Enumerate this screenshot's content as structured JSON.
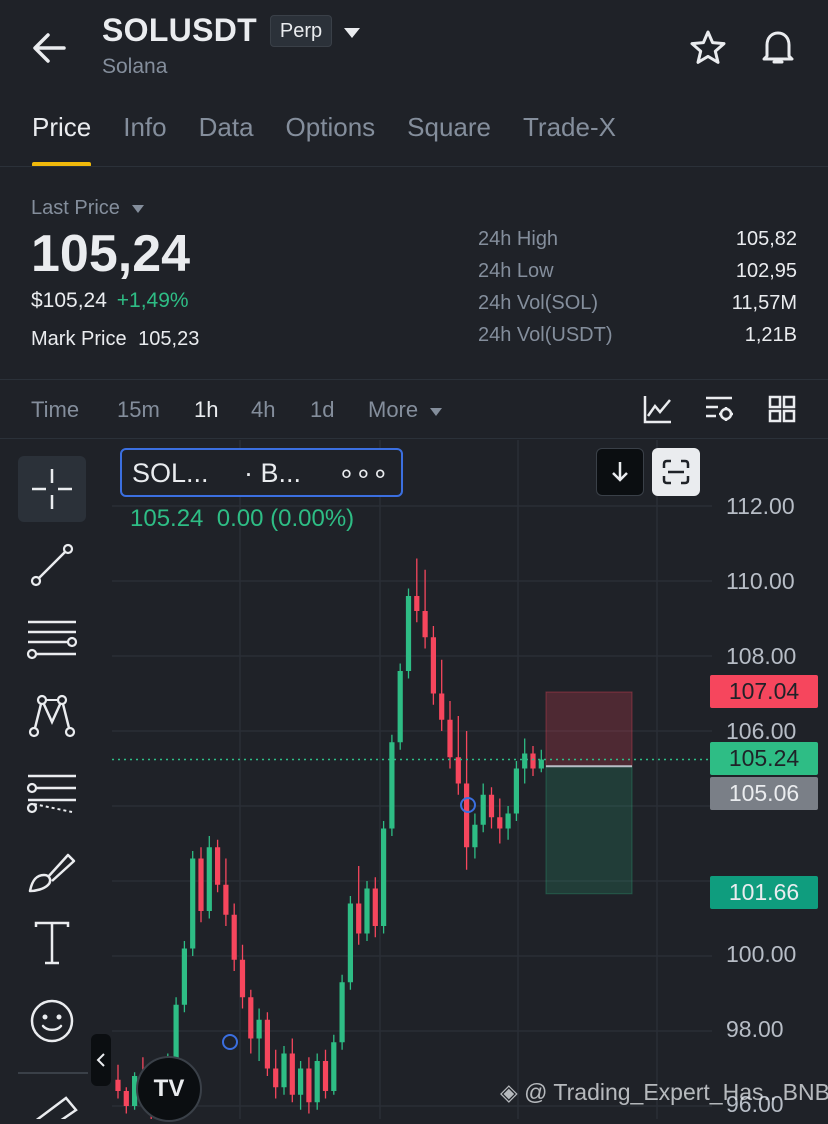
{
  "header": {
    "symbol": "SOLUSDT",
    "contract_type": "Perp",
    "name": "Solana"
  },
  "tabs": [
    "Price",
    "Info",
    "Data",
    "Options",
    "Square",
    "Trade-X"
  ],
  "active_tab": "Price",
  "ticker": {
    "last_price_label": "Last Price",
    "last_price": "105,24",
    "usd_price": "$105,24",
    "change_pct": "+1,49%",
    "mark_price_label": "Mark Price",
    "mark_price": "105,23",
    "stats": [
      {
        "label": "24h High",
        "value": "105,82"
      },
      {
        "label": "24h Low",
        "value": "102,95"
      },
      {
        "label": "24h Vol(SOL)",
        "value": "11,57M"
      },
      {
        "label": "24h Vol(USDT)",
        "value": "1,21B"
      }
    ]
  },
  "timeframes": {
    "time_label": "Time",
    "options": [
      "15m",
      "1h",
      "4h",
      "1d"
    ],
    "selected": "1h",
    "more_label": "More"
  },
  "chart": {
    "legend_symbol": "SOL...",
    "legend_exchange": "· B...",
    "legend_more": "∘∘∘",
    "ohlc_line": "105.24  0.00 (0.00%)",
    "axis_labels": [
      "112.00",
      "110.00",
      "108.00",
      "106.00",
      "100.00",
      "98.00",
      "96.00"
    ],
    "price_tags": [
      {
        "value": "107.04",
        "color": "#f6465d"
      },
      {
        "value": "105.24",
        "color": "#2ebd85"
      },
      {
        "value": "105.06",
        "color": "#7a7f87"
      },
      {
        "value": "101.66",
        "color": "#0f9d7e"
      }
    ],
    "watermark": "@ Trading_Expert_Has.. BNB",
    "colors": {
      "up": "#2ebd85",
      "down": "#f6465d",
      "bg": "#1f2228",
      "grid": "#2a2e36"
    }
  },
  "chart_data": {
    "type": "candlestick",
    "title": "",
    "ylim": [
      95.5,
      112.8
    ],
    "current_price": 105.24,
    "position": {
      "take_profit": 107.04,
      "entry": 105.06,
      "stop": 101.66
    },
    "series": [
      {
        "values": [
          [
            96.7,
            97.1,
            96.2,
            96.4
          ],
          [
            96.4,
            96.5,
            95.8,
            96.0
          ],
          [
            96.0,
            96.9,
            95.9,
            96.8
          ],
          [
            96.8,
            97.3,
            96.4,
            96.6
          ],
          [
            96.6,
            96.7,
            95.6,
            95.9
          ],
          [
            95.9,
            96.8,
            95.7,
            96.6
          ],
          [
            96.6,
            97.4,
            96.5,
            97.2
          ],
          [
            97.2,
            98.9,
            97.0,
            98.7
          ],
          [
            98.7,
            100.4,
            98.5,
            100.2
          ],
          [
            100.2,
            102.8,
            100.0,
            102.6
          ],
          [
            102.6,
            102.9,
            100.9,
            101.2
          ],
          [
            101.2,
            103.2,
            101.0,
            102.9
          ],
          [
            102.9,
            103.1,
            101.7,
            101.9
          ],
          [
            101.9,
            102.6,
            100.8,
            101.1
          ],
          [
            101.1,
            101.4,
            99.6,
            99.9
          ],
          [
            99.9,
            100.3,
            98.6,
            98.9
          ],
          [
            98.9,
            99.1,
            97.4,
            97.8
          ],
          [
            97.8,
            98.6,
            97.2,
            98.3
          ],
          [
            98.3,
            98.5,
            96.8,
            97.0
          ],
          [
            97.0,
            97.5,
            96.2,
            96.5
          ],
          [
            96.5,
            97.6,
            96.3,
            97.4
          ],
          [
            97.4,
            97.8,
            96.1,
            96.3
          ],
          [
            96.3,
            97.2,
            95.9,
            97.0
          ],
          [
            97.0,
            97.3,
            95.8,
            96.1
          ],
          [
            96.1,
            97.4,
            95.9,
            97.2
          ],
          [
            97.2,
            97.5,
            96.2,
            96.4
          ],
          [
            96.4,
            97.9,
            96.3,
            97.7
          ],
          [
            97.7,
            99.5,
            97.5,
            99.3
          ],
          [
            99.3,
            101.6,
            99.1,
            101.4
          ],
          [
            101.4,
            102.4,
            100.3,
            100.6
          ],
          [
            100.6,
            102.0,
            100.4,
            101.8
          ],
          [
            101.8,
            102.1,
            100.5,
            100.8
          ],
          [
            100.8,
            103.6,
            100.6,
            103.4
          ],
          [
            103.4,
            105.9,
            103.2,
            105.7
          ],
          [
            105.7,
            107.8,
            105.5,
            107.6
          ],
          [
            107.6,
            109.8,
            107.4,
            109.6
          ],
          [
            109.6,
            110.6,
            108.9,
            109.2
          ],
          [
            109.2,
            110.3,
            108.2,
            108.5
          ],
          [
            108.5,
            108.8,
            106.7,
            107.0
          ],
          [
            107.0,
            107.9,
            106.0,
            106.3
          ],
          [
            106.3,
            106.8,
            105.0,
            105.3
          ],
          [
            105.3,
            106.4,
            104.3,
            104.6
          ],
          [
            104.6,
            106.0,
            102.3,
            102.9
          ],
          [
            102.9,
            103.8,
            102.6,
            103.5
          ],
          [
            103.5,
            104.6,
            103.3,
            104.3
          ],
          [
            104.3,
            104.5,
            103.4,
            103.7
          ],
          [
            103.7,
            104.2,
            103.0,
            103.4
          ],
          [
            103.4,
            104.0,
            103.1,
            103.8
          ],
          [
            103.8,
            105.2,
            103.6,
            105.0
          ],
          [
            105.0,
            105.8,
            104.6,
            105.4
          ],
          [
            105.4,
            105.6,
            104.8,
            105.0
          ],
          [
            105.0,
            105.5,
            104.9,
            105.24
          ]
        ]
      }
    ]
  }
}
